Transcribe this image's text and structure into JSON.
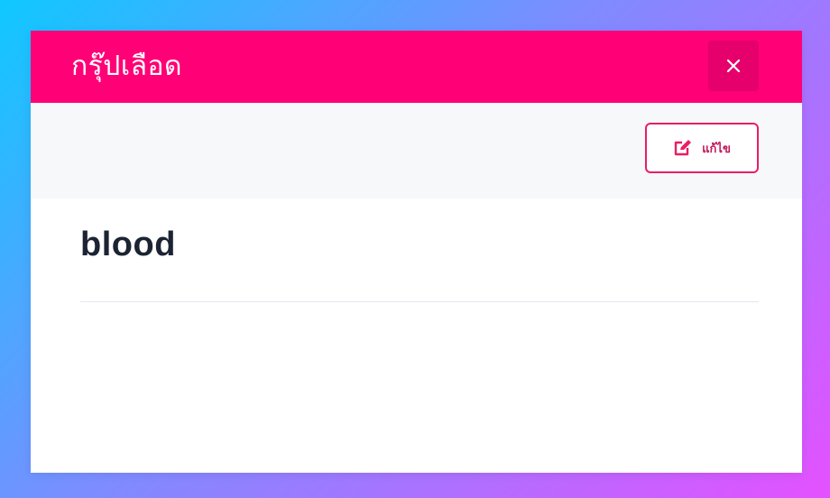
{
  "modal": {
    "title": "กรุ๊ปเลือด",
    "close_icon": "close-icon",
    "edit_label": "แก้ไข",
    "edit_icon": "edit-icon",
    "value": "blood"
  },
  "colors": {
    "header": "#ff0077",
    "accent": "#e91e63",
    "toolbar": "#f6f8fa"
  }
}
